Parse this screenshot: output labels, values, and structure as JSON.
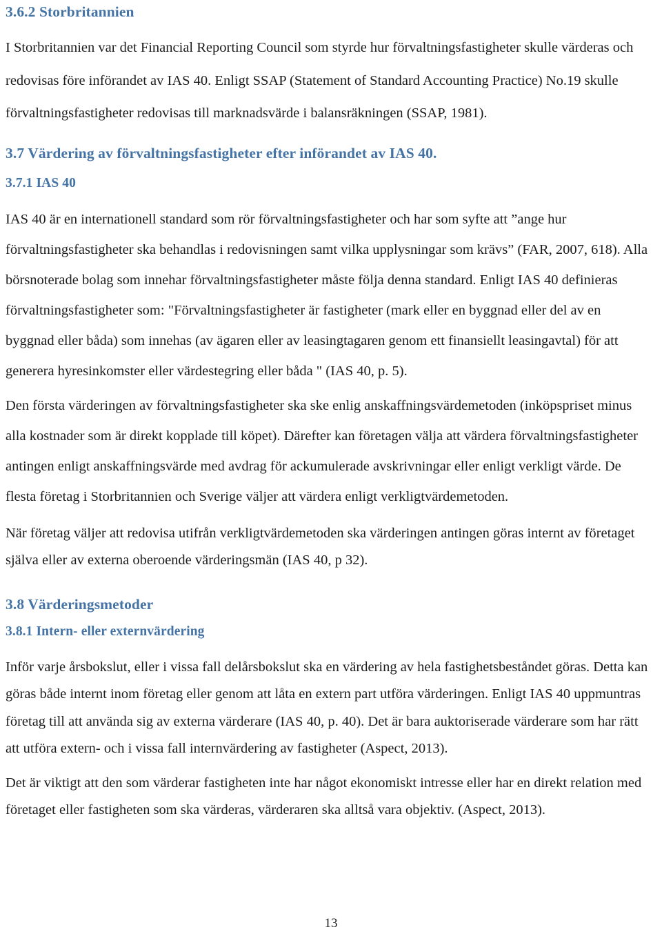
{
  "document": {
    "page_number": "13",
    "language": "sv",
    "heading_color": "#4473a5",
    "body_color": "#1c1c1c",
    "background_color": "#ffffff"
  },
  "sections": {
    "s362": {
      "heading": "3.6.2 Storbritannien",
      "paragraph": "I Storbritannien var det Financial Reporting Council som styrde hur förvaltningsfastigheter skulle värderas och redovisas före införandet av IAS 40. Enligt SSAP (Statement of Standard Accounting Practice) No.19 skulle förvaltningsfastigheter redovisas till marknadsvärde i balansräkningen (SSAP, 1981)."
    },
    "s37": {
      "heading": "3.7 Värdering av förvaltningsfastigheter efter införandet av IAS 40."
    },
    "s371": {
      "heading": "3.7.1 IAS 40",
      "paragraph_1": "IAS 40 är en internationell standard som rör förvaltningsfastigheter och har som syfte att ”ange hur förvaltningsfastigheter ska behandlas i redovisningen samt vilka upplysningar som krävs” (FAR, 2007, 618). Alla börsnoterade bolag som innehar förvaltningsfastigheter måste följa denna standard. Enligt IAS 40 definieras förvaltningsfastigheter som: \"Förvaltningsfastigheter är fastigheter (mark eller en byggnad eller del av en byggnad eller båda) som innehas (av ägaren eller av leasingtagaren genom ett finansiellt leasingavtal) för att generera hyresinkomster eller värdestegring eller båda \" (IAS 40, p. 5).",
      "paragraph_2": "Den första värderingen av förvaltningsfastigheter ska ske enlig anskaffningsvärdemetoden (inköpspriset minus alla kostnader som är direkt kopplade till köpet). Därefter kan företagen välja att värdera förvaltningsfastigheter antingen enligt anskaffningsvärde med avdrag för ackumulerade avskrivningar eller enligt verkligt värde. De flesta företag i Storbritannien och Sverige väljer att värdera enligt verkligtvärdemetoden.",
      "paragraph_3": "När företag väljer att redovisa utifrån verkligtvärdemetoden ska värderingen antingen göras internt av företaget själva eller av externa oberoende värderingsmän (IAS 40, p 32)."
    },
    "s38": {
      "heading": "3.8 Värderingsmetoder"
    },
    "s381": {
      "heading": "3.8.1 Intern- eller externvärdering",
      "paragraph_1": "Inför varje årsbokslut, eller i vissa fall delårsbokslut ska en värdering av hela fastighetsbeståndet göras. Detta kan göras både internt inom företag eller genom att låta en extern part utföra värderingen. Enligt IAS 40 uppmuntras företag till att använda sig av externa värderare (IAS 40, p. 40). Det är bara auktoriserade värderare som har rätt att utföra extern- och i vissa fall internvärdering av fastigheter (Aspect, 2013).",
      "paragraph_2": "Det är viktigt att den som värderar fastigheten inte har något ekonomiskt intresse eller har en direkt relation med företaget eller fastigheten som ska värderas, värderaren ska alltså vara objektiv. (Aspect, 2013)."
    }
  }
}
